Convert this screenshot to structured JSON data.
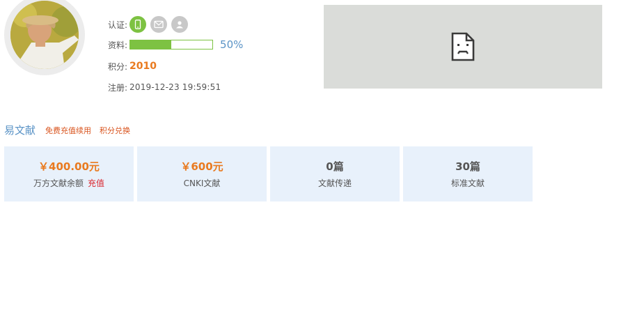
{
  "profile": {
    "verify_label": "认证:",
    "profile_label": "资料:",
    "profile_progress": 0.5,
    "profile_percent": "50%",
    "points_label": "积分:",
    "points_value": "2010",
    "reg_label": "注册:",
    "reg_value": "2019-12-23 19:59:51",
    "verify_icons": [
      "phone-icon",
      "mail-icon",
      "user-icon"
    ],
    "verify_active": "phone-icon"
  },
  "colors": {
    "accent_green": "#7dc242",
    "accent_orange": "#e97a1f",
    "link_blue": "#5a93c6",
    "link_red": "#d9541e",
    "card_bg": "#e8f1fb"
  },
  "section": {
    "title": "易文献",
    "links": [
      "免费充值续用",
      "积分兑换"
    ]
  },
  "cards": [
    {
      "value": "￥400.00元",
      "label": "万方文献余额",
      "action": "充值"
    },
    {
      "value": "￥600元",
      "label": "CNKI文献"
    },
    {
      "value": "0篇",
      "label": "文献传递"
    },
    {
      "value": "30篇",
      "label": "标准文献"
    }
  ]
}
